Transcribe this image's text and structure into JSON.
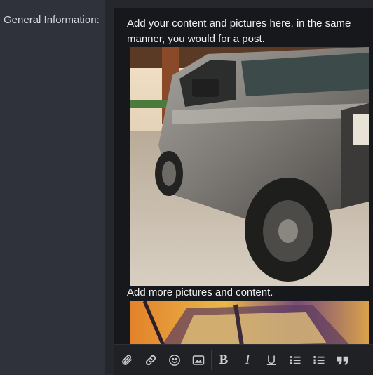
{
  "form": {
    "label": "General Information:"
  },
  "editor": {
    "paragraph1": "Add your content and pictures here, in the same manner, you would for a post.",
    "paragraph2": "Add more pictures and content."
  },
  "toolbar": {
    "buttons": [
      "attach-icon",
      "link-icon",
      "emoji-icon",
      "image-icon",
      "bold-icon",
      "italic-icon",
      "underline-icon",
      "bullet-list-icon",
      "numbered-list-icon",
      "quote-icon"
    ],
    "bold_label": "B",
    "italic_label": "I",
    "underline_label": "U"
  }
}
